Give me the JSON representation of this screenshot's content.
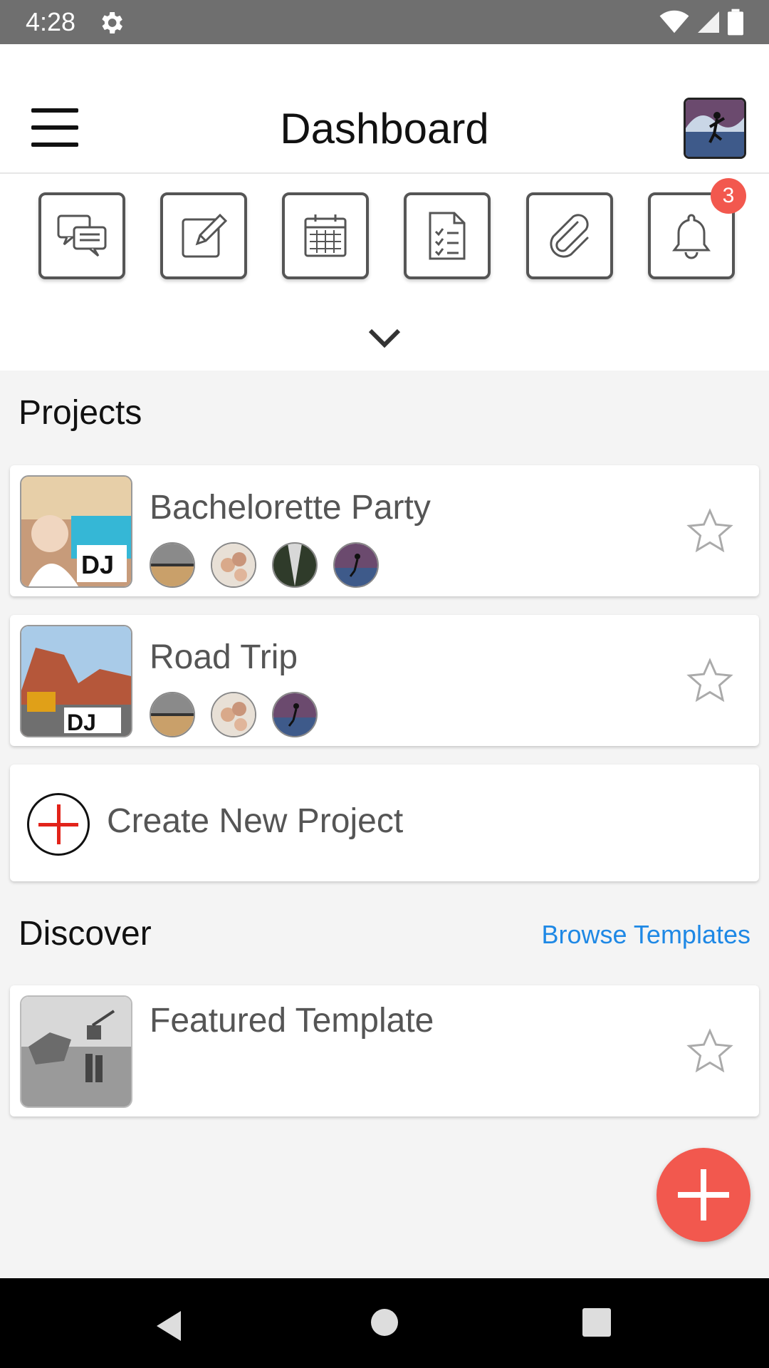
{
  "status_bar": {
    "time": "4:28"
  },
  "header": {
    "title": "Dashboard"
  },
  "quick_actions": {
    "items": [
      "chat-icon",
      "edit-icon",
      "calendar-icon",
      "checklist-icon",
      "attachment-icon",
      "bell-icon"
    ],
    "notification_count": "3"
  },
  "projects": {
    "title": "Projects",
    "items": [
      {
        "name": "Bachelorette Party",
        "members": 4
      },
      {
        "name": "Road Trip",
        "members": 3
      }
    ],
    "create_label": "Create New Project"
  },
  "discover": {
    "title": "Discover",
    "browse_label": "Browse Templates",
    "featured": {
      "name": "Featured Template"
    }
  },
  "colors": {
    "accent": "#f2584e",
    "link": "#1e88e5"
  }
}
